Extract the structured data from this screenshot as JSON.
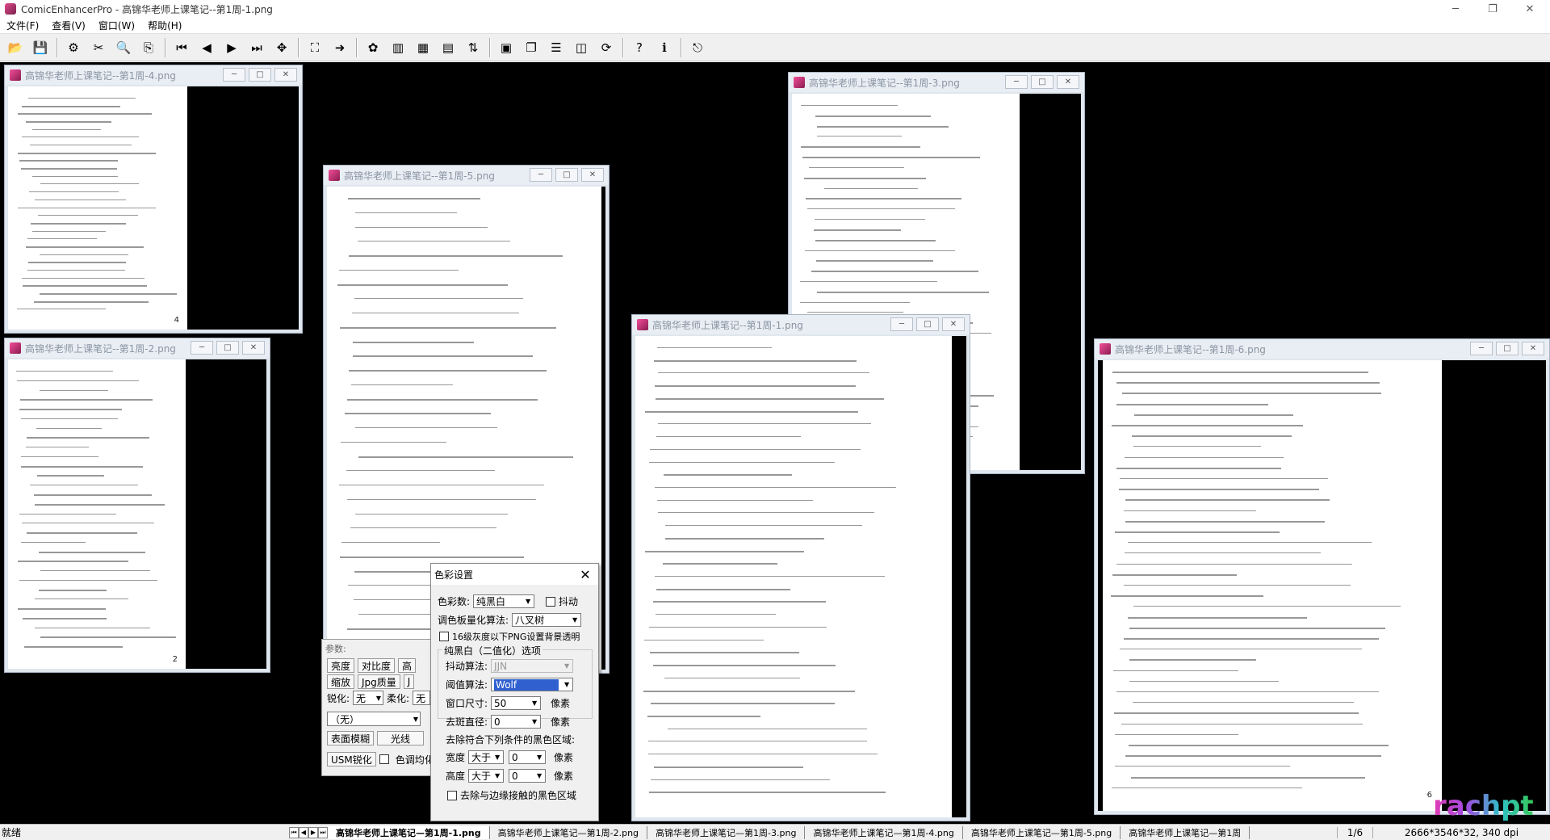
{
  "window": {
    "title": "ComicEnhancerPro - 高锦华老师上课笔记--第1周-1.png"
  },
  "menu": [
    "文件(F)",
    "查看(V)",
    "窗口(W)",
    "帮助(H)"
  ],
  "toolbar_icons": [
    "open-icon",
    "save-icon",
    "|",
    "batch-icon",
    "cut-icon",
    "zoom-icon",
    "copy-icon",
    "|",
    "first-icon",
    "prev-icon",
    "next-icon",
    "last-icon",
    "move-icon",
    "|",
    "fit-icon",
    "export-icon",
    "|",
    "color-icon",
    "levels-icon",
    "palette-icon",
    "filter-icon",
    "sort-icon",
    "|",
    "tile-icon",
    "cascade-icon",
    "split-h-icon",
    "split-v-icon",
    "sync-icon",
    "|",
    "help-icon",
    "info-icon",
    "|",
    "exit-icon"
  ],
  "documents": [
    {
      "title": "高锦华老师上课笔记--第1周-4.png",
      "page_no": "4"
    },
    {
      "title": "高锦华老师上课笔记--第1周-2.png",
      "page_no": "2"
    },
    {
      "title": "高锦华老师上课笔记--第1周-5.png",
      "page_no": ""
    },
    {
      "title": "高锦华老师上课笔记--第1周-3.png",
      "page_no": ""
    },
    {
      "title": "高锦华老师上课笔记--第1周-1.png",
      "page_no": ""
    },
    {
      "title": "高锦华老师上课笔记--第1周-6.png",
      "page_no": "6"
    }
  ],
  "params": {
    "title": "参数:",
    "brightness": "亮度",
    "contrast": "对比度",
    "high": "高",
    "scale": "缩放",
    "jpg_quality": "Jpg质量",
    "j": "J",
    "sharpen_label": "锐化:",
    "sharpen_value": "无",
    "soften_label": "柔化:",
    "soften_value": "无",
    "filter_value": "（无）",
    "surface_blur": "表面模糊",
    "lighting": "光线",
    "usm_sharpen": "USM锐化",
    "tone_equalize": "色调均化"
  },
  "dialog": {
    "title": "色彩设置",
    "color_count_label": "色彩数:",
    "color_count_value": "纯黑白",
    "dither_label": "抖动",
    "palette_algo_label": "调色板量化算法:",
    "palette_algo_value": "八叉树",
    "png_transparent_label": "16级灰度以下PNG设置背景透明",
    "bw_group_label": "纯黑白（二值化）选项",
    "dither_algo_label": "抖动算法:",
    "dither_algo_value": "JJN",
    "threshold_algo_label": "阈值算法:",
    "threshold_algo_value": "Wolf",
    "window_size_label": "窗口尺寸:",
    "window_size_value": "50",
    "px1": "像素",
    "despeckle_label": "去斑直径:",
    "despeckle_value": "0",
    "px2": "像素",
    "remove_black_label": "去除符合下列条件的黑色区域:",
    "width_label": "宽度",
    "width_op": "大于",
    "width_value": "0",
    "px3": "像素",
    "height_label": "高度",
    "height_op": "大于",
    "height_value": "0",
    "px4": "像素",
    "remove_edge_label": "去除与边缘接触的黑色区域"
  },
  "status": {
    "text": "就绪",
    "tabs": [
      "高锦华老师上课笔记—第1周-1.png",
      "高锦华老师上课笔记—第1周-2.png",
      "高锦华老师上课笔记—第1周-3.png",
      "高锦华老师上课笔记—第1周-4.png",
      "高锦华老师上课笔记—第1周-5.png",
      "高锦华老师上课笔记—第1周"
    ],
    "count": "1/6",
    "info": "2666*3546*32, 340 dpi"
  },
  "watermark": "rachpt"
}
